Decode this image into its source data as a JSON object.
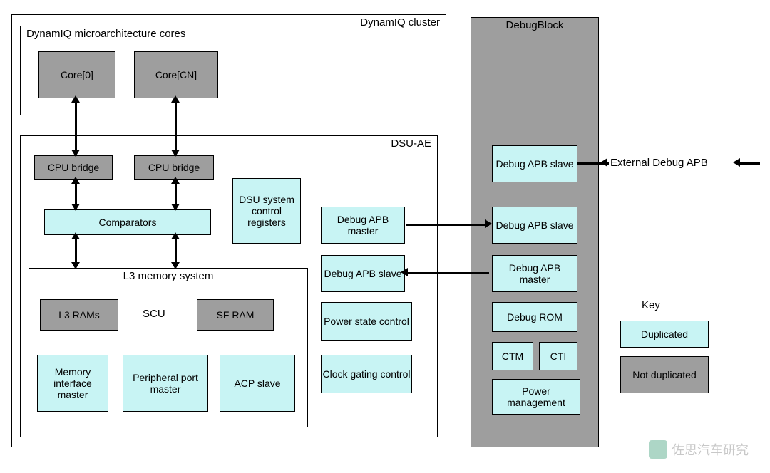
{
  "dynamiq_cluster": {
    "label": "DynamIQ cluster"
  },
  "micro_cores": {
    "label": "DynamIQ microarchitecture cores"
  },
  "core0": "Core[0]",
  "coreCN": "Core[CN]",
  "dsu_ae": {
    "label": "DSU-AE"
  },
  "cpu_bridge": "CPU bridge",
  "comparators": "Comparators",
  "dsu_sys_ctrl": "DSU system control registers",
  "debug_apb_master": "Debug APB master",
  "debug_apb_slave": "Debug APB slave",
  "l3_mem_sys": {
    "label": "L3 memory system"
  },
  "l3_rams": "L3 RAMs",
  "scu": "SCU",
  "sf_ram": "SF RAM",
  "mem_if_master": "Memory interface master",
  "periph_port_master": "Peripheral port master",
  "acp_slave": "ACP slave",
  "power_state_ctrl": "Power state control",
  "clock_gating_ctrl": "Clock gating control",
  "debugblock": {
    "label": "DebugBlock"
  },
  "debug_rom": "Debug ROM",
  "ctm": "CTM",
  "cti": "CTI",
  "power_mgmt": "Power management",
  "external_debug_apb": "External Debug APB",
  "key": {
    "title": "Key",
    "duplicated": "Duplicated",
    "not_duplicated": "Not duplicated"
  },
  "watermark": "佐思汽车研究"
}
